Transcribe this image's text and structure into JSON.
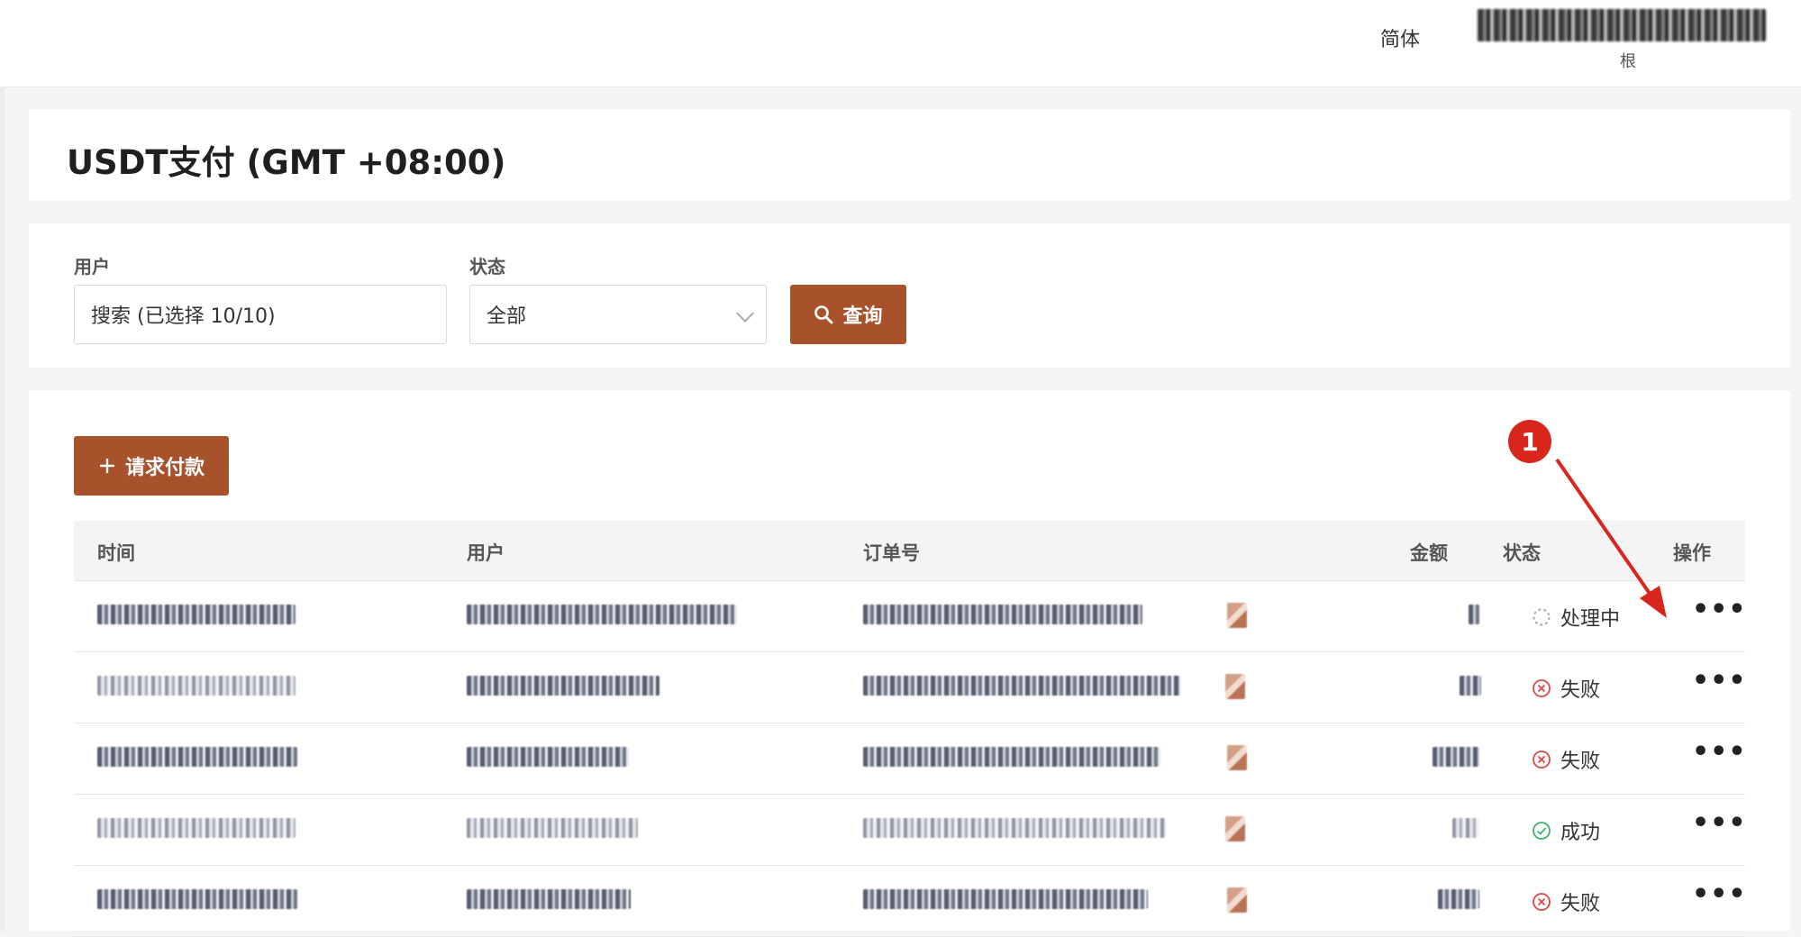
{
  "header": {
    "language_label": "简体",
    "account_name": "",
    "account_role": "根"
  },
  "page": {
    "title": "USDT支付 (GMT +08:00)"
  },
  "filters": {
    "user_label": "用户",
    "user_value": "搜索 (已选择 10/10)",
    "status_label": "状态",
    "status_value": "全部",
    "query_button": "查询"
  },
  "actions": {
    "request_payment": "请求付款"
  },
  "table": {
    "columns": {
      "time": "时间",
      "user": "用户",
      "order": "订单号",
      "amount": "金额",
      "status": "状态",
      "operation": "操作"
    },
    "rows": [
      {
        "status": "处理中",
        "status_type": "processing",
        "more": "•••"
      },
      {
        "status": "失败",
        "status_type": "failed",
        "more": "•••"
      },
      {
        "status": "失败",
        "status_type": "failed",
        "more": "•••"
      },
      {
        "status": "成功",
        "status_type": "success",
        "more": "•••"
      },
      {
        "status": "失败",
        "status_type": "failed",
        "more": "•••"
      }
    ]
  },
  "annotation": {
    "number": "1",
    "color": "#d9261c"
  },
  "colors": {
    "accent": "#a8522c",
    "failed": "#e04545",
    "success": "#3bb36a",
    "processing": "#999999"
  },
  "icons": {
    "search": "search-icon",
    "plus": "plus-icon",
    "chevron": "chevron-down-icon",
    "more": "more-icon",
    "failed": "close-circle-icon",
    "success": "check-circle-icon",
    "processing": "spinner-icon",
    "copy": "copy-icon"
  }
}
